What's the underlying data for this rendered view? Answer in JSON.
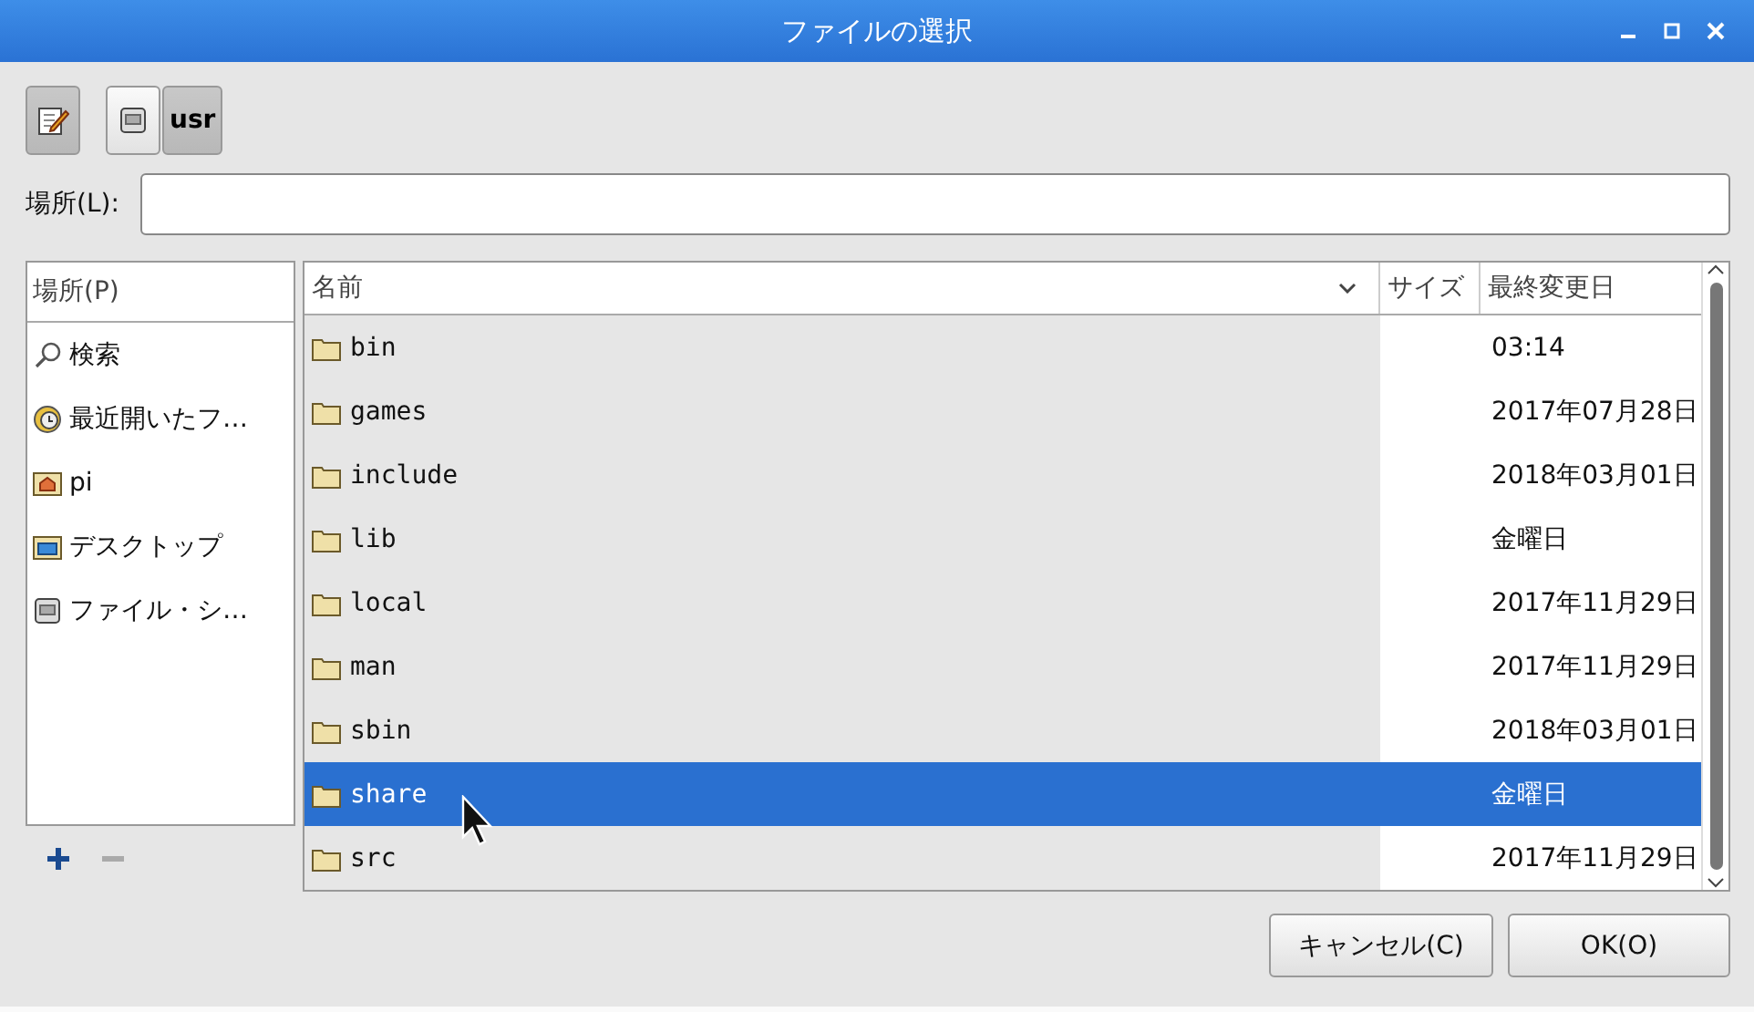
{
  "window": {
    "title": "ファイルの選択"
  },
  "toolbar": {
    "edit_toggle": {
      "on": true
    },
    "path": [
      {
        "kind": "drive",
        "selected": false
      },
      {
        "kind": "folder",
        "label": "usr",
        "selected": true
      }
    ]
  },
  "location": {
    "label": "場所(L):"
  },
  "places": {
    "header": "場所(P)",
    "items": [
      {
        "kind": "search",
        "label": "検索"
      },
      {
        "kind": "recent",
        "label": "最近開いたフ…"
      },
      {
        "kind": "home",
        "label": "pi"
      },
      {
        "kind": "desktop",
        "label": "デスクトップ"
      },
      {
        "kind": "drive",
        "label": "ファイル・シ…"
      }
    ],
    "actions": [
      {
        "kind": "add",
        "disabled": false
      },
      {
        "kind": "remove",
        "disabled": true
      }
    ]
  },
  "file_list": {
    "columns": [
      {
        "label": "名前",
        "sorted": true
      },
      {
        "label": "サイズ",
        "sorted": false
      },
      {
        "label": "最終変更日",
        "sorted": false
      }
    ],
    "rows": [
      {
        "name": "bin",
        "modified": "03:14",
        "selected": false
      },
      {
        "name": "games",
        "modified": "2017年07月28日",
        "selected": false
      },
      {
        "name": "include",
        "modified": "2018年03月01日",
        "selected": false
      },
      {
        "name": "lib",
        "modified": "金曜日",
        "selected": false
      },
      {
        "name": "local",
        "modified": "2017年11月29日",
        "selected": false
      },
      {
        "name": "man",
        "modified": "2017年11月29日",
        "selected": false
      },
      {
        "name": "sbin",
        "modified": "2018年03月01日",
        "selected": false
      },
      {
        "name": "share",
        "modified": "金曜日",
        "selected": true
      },
      {
        "name": "src",
        "modified": "2017年11月29日",
        "selected": false
      }
    ]
  },
  "buttons": [
    {
      "label": "キャンセル(C)"
    },
    {
      "label": "OK(O)"
    }
  ]
}
